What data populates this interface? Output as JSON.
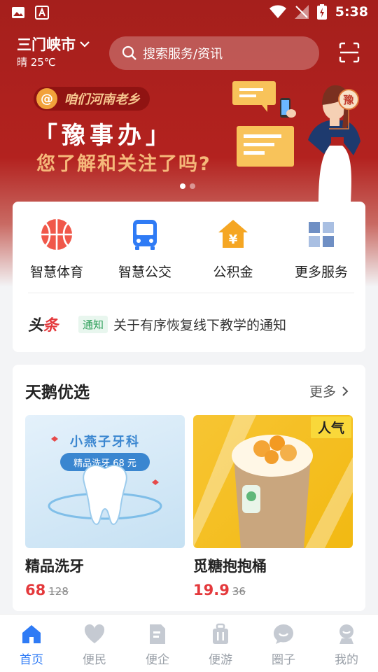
{
  "status_bar": {
    "time": "5:38"
  },
  "header": {
    "city": "三门峡市",
    "weather": "晴 25℃",
    "search_placeholder": "搜索服务/资讯"
  },
  "banner": {
    "pill_text": "咱们河南老乡",
    "title": "「豫事办」",
    "subtitle": "您了解和关注了吗?",
    "seal_text": "豫",
    "page_count": 2,
    "active_page": 1
  },
  "services": [
    {
      "label": "智慧体育",
      "icon": "basketball-icon",
      "color": "#f0584a"
    },
    {
      "label": "智慧公交",
      "icon": "bus-icon",
      "color": "#2f7bf5"
    },
    {
      "label": "公积金",
      "icon": "house-fund-icon",
      "color": "#f5a623"
    },
    {
      "label": "更多服务",
      "icon": "grid-icon",
      "color": "#6f8fc4"
    }
  ],
  "news": {
    "logo_a": "头",
    "logo_b": "条",
    "tag": "通知",
    "text": "关于有序恢复线下教学的通知"
  },
  "picks": {
    "title": "天鹅优选",
    "more_label": "更多",
    "items": [
      {
        "name": "精品洗牙",
        "price": "68",
        "old_price": "128",
        "brand": "小燕子牙科",
        "badge": "精品洗牙 68 元"
      },
      {
        "name": "觅糖抱抱桶",
        "price": "19.9",
        "old_price": "36",
        "hot_label": "人气"
      }
    ]
  },
  "tabs": [
    {
      "label": "首页",
      "icon": "home-icon",
      "active": true
    },
    {
      "label": "便民",
      "icon": "heart-icon",
      "active": false
    },
    {
      "label": "便企",
      "icon": "document-icon",
      "active": false
    },
    {
      "label": "便游",
      "icon": "luggage-icon",
      "active": false
    },
    {
      "label": "圈子",
      "icon": "chat-bubble-icon",
      "active": false
    },
    {
      "label": "我的",
      "icon": "profile-icon",
      "active": false
    }
  ],
  "colors": {
    "brand_red": "#a51f1c",
    "accent_blue": "#2f7bf5",
    "price_red": "#e4393c"
  }
}
